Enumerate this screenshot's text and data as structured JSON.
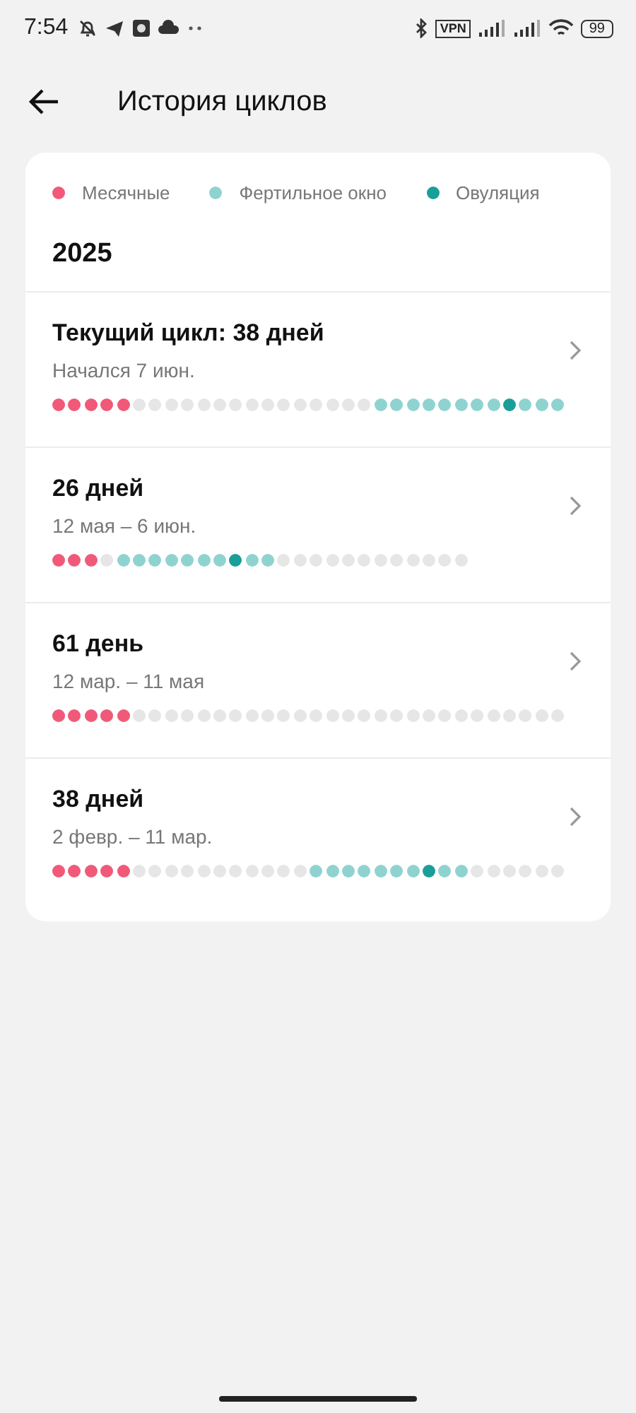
{
  "status_bar": {
    "time": "7:54",
    "vpn": "VPN",
    "battery": "99"
  },
  "header": {
    "title": "История циклов"
  },
  "legend": [
    {
      "kind": "period",
      "label": "Месячные",
      "color": "#f05a78"
    },
    {
      "kind": "fertile",
      "label": "Фертильное окно",
      "color": "#8fd3d0"
    },
    {
      "kind": "ovulation",
      "label": "Овуляция",
      "color": "#1a9e9a"
    }
  ],
  "year": "2025",
  "cycles": [
    {
      "title": "Текущий цикл: 38 дней",
      "subtitle": "Начался 7 июн.",
      "days": [
        {
          "kind": "period"
        },
        {
          "kind": "period"
        },
        {
          "kind": "period"
        },
        {
          "kind": "period"
        },
        {
          "kind": "period"
        },
        {
          "kind": "none"
        },
        {
          "kind": "none"
        },
        {
          "kind": "none"
        },
        {
          "kind": "none"
        },
        {
          "kind": "none"
        },
        {
          "kind": "none"
        },
        {
          "kind": "none"
        },
        {
          "kind": "none"
        },
        {
          "kind": "none"
        },
        {
          "kind": "none"
        },
        {
          "kind": "none"
        },
        {
          "kind": "none"
        },
        {
          "kind": "none"
        },
        {
          "kind": "none"
        },
        {
          "kind": "none"
        },
        {
          "kind": "fertile"
        },
        {
          "kind": "fertile"
        },
        {
          "kind": "fertile"
        },
        {
          "kind": "fertile"
        },
        {
          "kind": "fertile"
        },
        {
          "kind": "fertile"
        },
        {
          "kind": "fertile"
        },
        {
          "kind": "fertile"
        },
        {
          "kind": "ovulation"
        },
        {
          "kind": "fertile"
        },
        {
          "kind": "fertile"
        },
        {
          "kind": "fertile"
        }
      ]
    },
    {
      "title": "26 дней",
      "subtitle": "12 мая – 6 июн.",
      "days": [
        {
          "kind": "period"
        },
        {
          "kind": "period"
        },
        {
          "kind": "period"
        },
        {
          "kind": "none"
        },
        {
          "kind": "fertile"
        },
        {
          "kind": "fertile"
        },
        {
          "kind": "fertile"
        },
        {
          "kind": "fertile"
        },
        {
          "kind": "fertile"
        },
        {
          "kind": "fertile"
        },
        {
          "kind": "fertile"
        },
        {
          "kind": "ovulation"
        },
        {
          "kind": "fertile"
        },
        {
          "kind": "fertile"
        },
        {
          "kind": "none"
        },
        {
          "kind": "none"
        },
        {
          "kind": "none"
        },
        {
          "kind": "none"
        },
        {
          "kind": "none"
        },
        {
          "kind": "none"
        },
        {
          "kind": "none"
        },
        {
          "kind": "none"
        },
        {
          "kind": "none"
        },
        {
          "kind": "none"
        },
        {
          "kind": "none"
        },
        {
          "kind": "none"
        }
      ]
    },
    {
      "title": "61 день",
      "subtitle": "12 мар. – 11 мая",
      "days": [
        {
          "kind": "period"
        },
        {
          "kind": "period"
        },
        {
          "kind": "period"
        },
        {
          "kind": "period"
        },
        {
          "kind": "period"
        },
        {
          "kind": "none"
        },
        {
          "kind": "none"
        },
        {
          "kind": "none"
        },
        {
          "kind": "none"
        },
        {
          "kind": "none"
        },
        {
          "kind": "none"
        },
        {
          "kind": "none"
        },
        {
          "kind": "none"
        },
        {
          "kind": "none"
        },
        {
          "kind": "none"
        },
        {
          "kind": "none"
        },
        {
          "kind": "none"
        },
        {
          "kind": "none"
        },
        {
          "kind": "none"
        },
        {
          "kind": "none"
        },
        {
          "kind": "none"
        },
        {
          "kind": "none"
        },
        {
          "kind": "none"
        },
        {
          "kind": "none"
        },
        {
          "kind": "none"
        },
        {
          "kind": "none"
        },
        {
          "kind": "none"
        },
        {
          "kind": "none"
        },
        {
          "kind": "none"
        },
        {
          "kind": "none"
        },
        {
          "kind": "none"
        },
        {
          "kind": "none"
        }
      ]
    },
    {
      "title": "38 дней",
      "subtitle": "2 февр. – 11 мар.",
      "days": [
        {
          "kind": "period"
        },
        {
          "kind": "period"
        },
        {
          "kind": "period"
        },
        {
          "kind": "period"
        },
        {
          "kind": "period"
        },
        {
          "kind": "none"
        },
        {
          "kind": "none"
        },
        {
          "kind": "none"
        },
        {
          "kind": "none"
        },
        {
          "kind": "none"
        },
        {
          "kind": "none"
        },
        {
          "kind": "none"
        },
        {
          "kind": "none"
        },
        {
          "kind": "none"
        },
        {
          "kind": "none"
        },
        {
          "kind": "none"
        },
        {
          "kind": "fertile"
        },
        {
          "kind": "fertile"
        },
        {
          "kind": "fertile"
        },
        {
          "kind": "fertile"
        },
        {
          "kind": "fertile"
        },
        {
          "kind": "fertile"
        },
        {
          "kind": "fertile"
        },
        {
          "kind": "ovulation"
        },
        {
          "kind": "fertile"
        },
        {
          "kind": "fertile"
        },
        {
          "kind": "none"
        },
        {
          "kind": "none"
        },
        {
          "kind": "none"
        },
        {
          "kind": "none"
        },
        {
          "kind": "none"
        },
        {
          "kind": "none"
        }
      ]
    }
  ]
}
